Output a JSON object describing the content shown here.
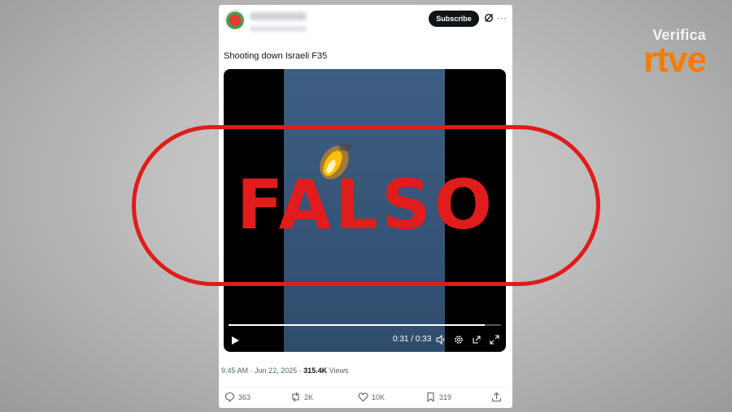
{
  "brand": {
    "line1": "Verifica",
    "line2": "rtve"
  },
  "post": {
    "subscribe_label": "Subscribe",
    "more_label": "···",
    "text": "Shooting down Israeli F35",
    "video": {
      "time": "0:31 / 0:33",
      "progress": 0.94
    },
    "meta": {
      "time": "9:45 AM",
      "date": "Jun 22, 2025",
      "views_count": "315.4K",
      "views_label": "Views"
    },
    "actions": {
      "replies": "363",
      "reposts": "2K",
      "likes": "10K",
      "bookmarks": "319"
    }
  },
  "stamp": {
    "text": "FALSO",
    "color": "#e01c1c"
  },
  "colors": {
    "brand_orange": "#f57c00",
    "button_dark": "#0f1419"
  }
}
